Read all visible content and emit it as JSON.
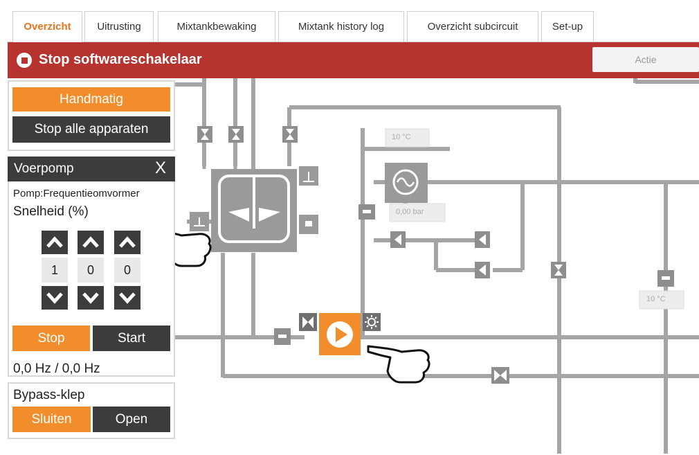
{
  "tabs": [
    {
      "label": "Overzicht",
      "active": true
    },
    {
      "label": "Uitrusting",
      "active": false
    },
    {
      "label": "Mixtankbewaking",
      "active": false
    },
    {
      "label": "Mixtank history log",
      "active": false
    },
    {
      "label": "Overzicht subcircuit",
      "active": false
    },
    {
      "label": "Set-up",
      "active": false
    }
  ],
  "header": {
    "title": "Stop softwareschakelaar",
    "action_label": "Actie",
    "color": "#b63330"
  },
  "control_panel": {
    "manual_label": "Handmatig",
    "stop_all_label": "Stop alle apparaten"
  },
  "voerpomp": {
    "title": "Voerpomp",
    "close_label": "X",
    "type_label": "Pomp:Frequentieomvormer",
    "speed_label": "Snelheid (%)",
    "digits": [
      "1",
      "0",
      "0"
    ],
    "stop_label": "Stop",
    "start_label": "Start",
    "frequency": "0,0 Hz / 0,0 Hz"
  },
  "bypass": {
    "title": "Bypass-klep",
    "close_label": "Sluiten",
    "open_label": "Open"
  },
  "diagram": {
    "temp_sensor_1": "10 °C",
    "pressure_sensor": "0,00 bar",
    "temp_sensor_2": "10 °C"
  },
  "colors": {
    "accent": "#f28d2c",
    "dark": "#3c3c3c",
    "pipe": "#a5a5a5"
  }
}
